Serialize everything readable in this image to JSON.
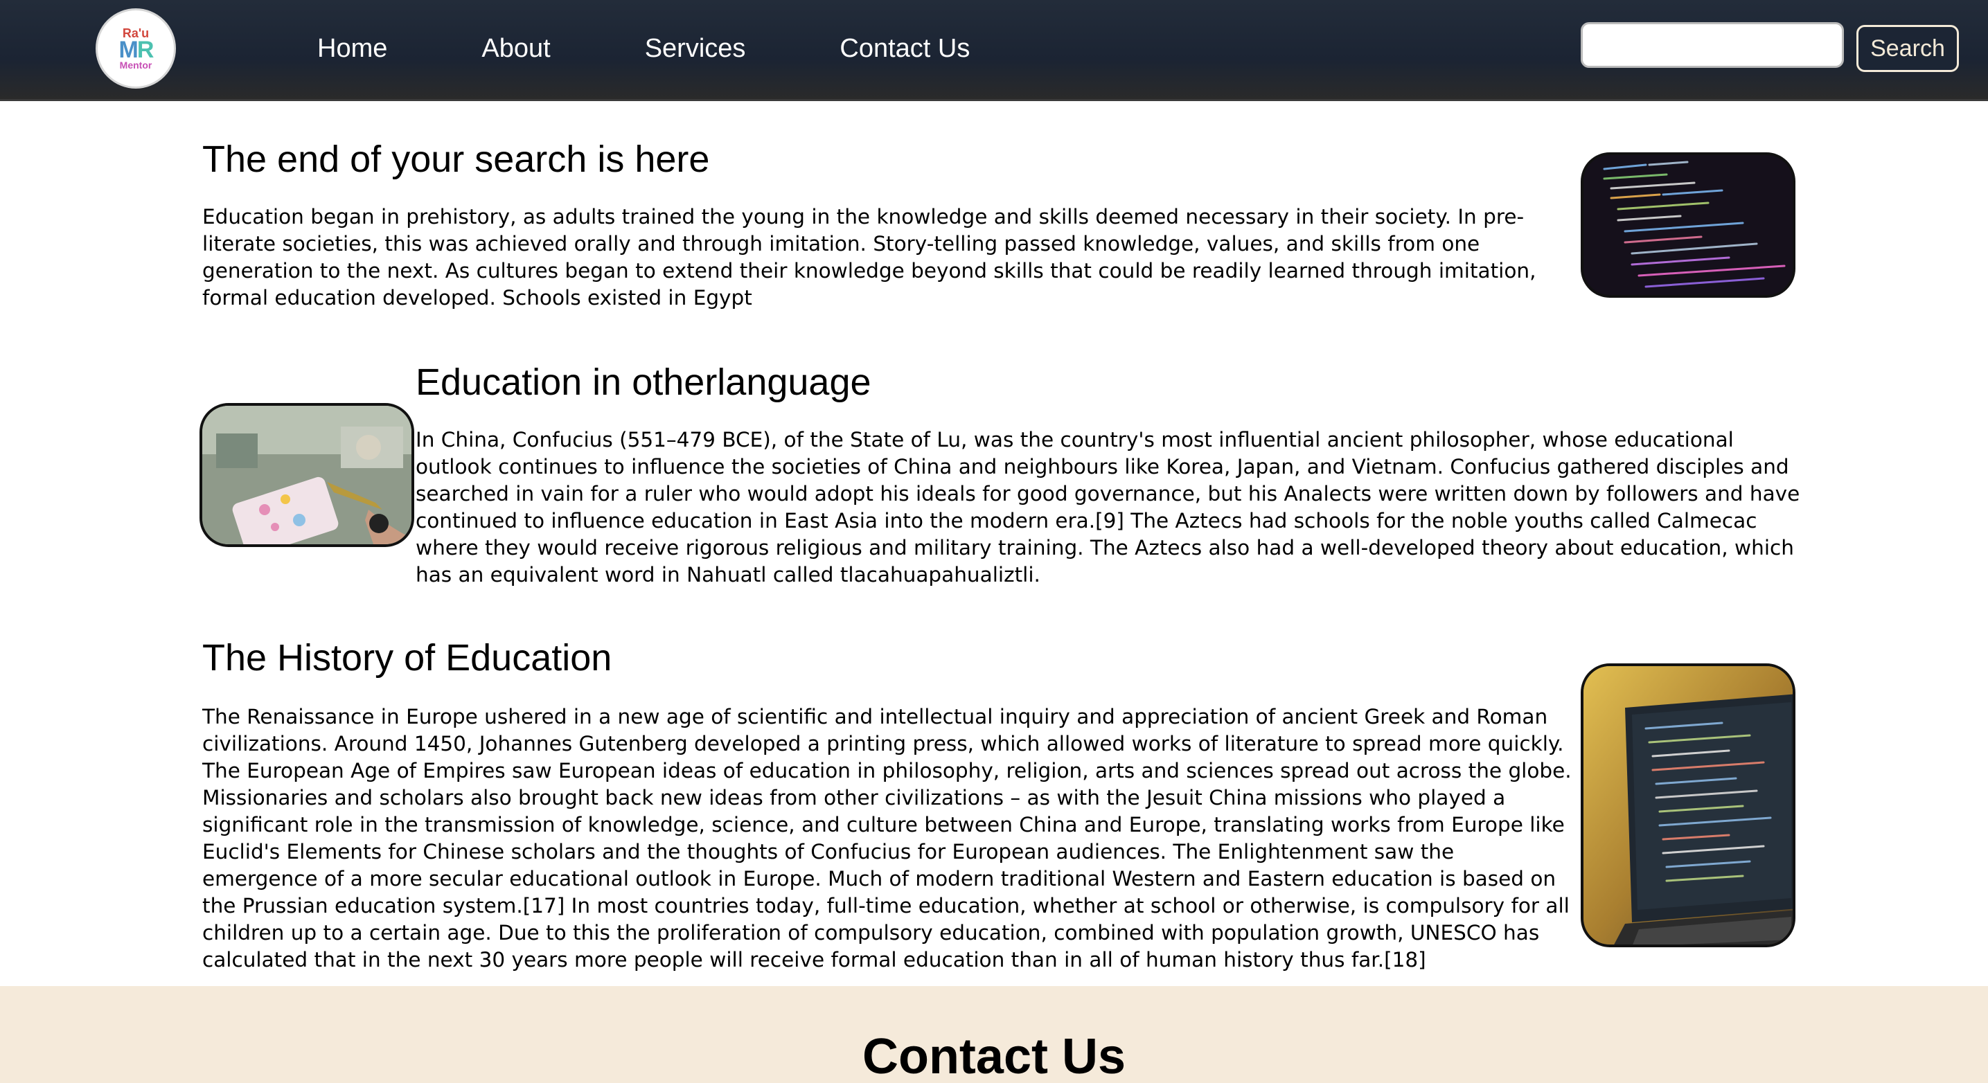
{
  "navbar": {
    "logo": {
      "line1": "Ra'u",
      "line2_m": "M",
      "line2_r": "R",
      "line3": "Mentor"
    },
    "links": [
      "Home",
      "About",
      "Services",
      "Contact Us"
    ],
    "search": {
      "placeholder": "",
      "value": "",
      "button_label": "Search"
    }
  },
  "sections": [
    {
      "title": "The end of your search is here",
      "body": "Education began in prehistory, as adults trained the young in the knowledge and skills deemed necessary in their society. In pre-literate societies, this was achieved orally and through imitation. Story-telling passed knowledge, values, and skills from one generation to the next. As cultures began to extend their knowledge beyond skills that could be readily learned through imitation, formal education developed. Schools existed in Egypt"
    },
    {
      "title": "Education in otherlanguage",
      "body": "In China, Confucius (551–479 BCE), of the State of Lu, was the country's most influential ancient philosopher, whose educational outlook continues to influence the societies of China and neighbours like Korea, Japan, and Vietnam. Confucius gathered disciples and searched in vain for a ruler who would adopt his ideals for good governance, but his Analects were written down by followers and have continued to influence education in East Asia into the modern era.[9] The Aztecs had schools for the noble youths called Calmecac where they would receive rigorous religious and military training. The Aztecs also had a well-developed theory about education, which has an equivalent word in Nahuatl called tlacahuapahualiztli."
    },
    {
      "title": "The History of Education",
      "body": "The Renaissance in Europe ushered in a new age of scientific and intellectual inquiry and appreciation of ancient Greek and Roman civilizations. Around 1450, Johannes Gutenberg developed a printing press, which allowed works of literature to spread more quickly. The European Age of Empires saw European ideas of education in philosophy, religion, arts and sciences spread out across the globe. Missionaries and scholars also brought back new ideas from other civilizations – as with the Jesuit China missions who played a significant role in the transmission of knowledge, science, and culture between China and Europe, translating works from Europe like Euclid's Elements for Chinese scholars and the thoughts of Confucius for European audiences. The Enlightenment saw the emergence of a more secular educational outlook in Europe. Much of modern traditional Western and Eastern education is based on the Prussian education system.[17] In most countries today, full-time education, whether at school or otherwise, is compulsory for all children up to a certain age. Due to this the proliferation of compulsory education, combined with population growth, UNESCO has calculated that in the next 30 years more people will receive formal education than in all of human history thus far.[18]"
    }
  ],
  "images": {
    "section1": "code-on-screen-image",
    "section2": "classroom-craft-image",
    "section3": "laptop-code-image"
  },
  "contact": {
    "title": "Contact Us"
  },
  "colors": {
    "navbar_bg": "#1b2433",
    "nav_text": "#ffffff",
    "search_button_border": "#f4ead8",
    "contact_bg": "#f5eada"
  }
}
